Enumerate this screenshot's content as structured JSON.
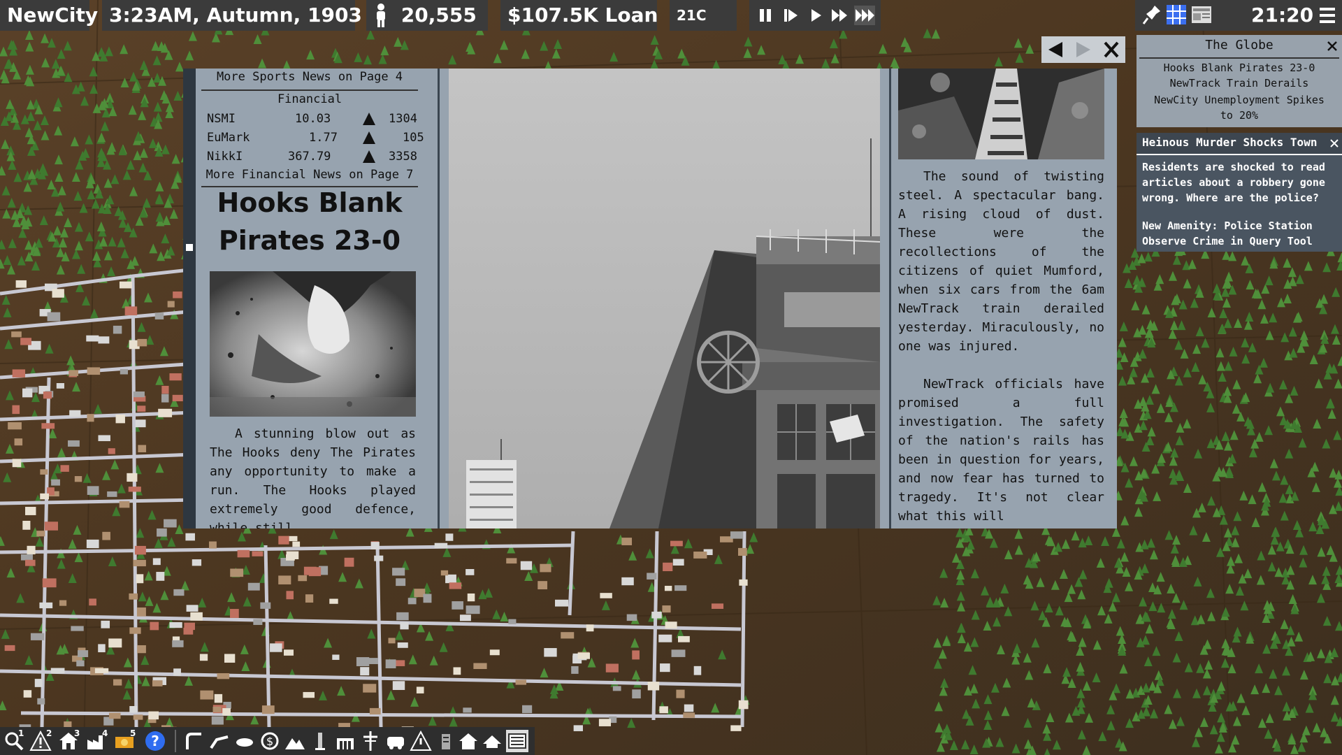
{
  "topbar": {
    "city_name": "NewCity",
    "datetime": "3:23AM, Autumn, 1903",
    "population": "20,555",
    "loan": "$107.5K Loan",
    "temperature": "21C",
    "clock": "21:20"
  },
  "newspaper": {
    "sports_more": "More Sports News on Page 4",
    "financial_heading": "Financial",
    "stocks": [
      {
        "name": "NSMI",
        "value": "10.03",
        "trend": "up",
        "volume": "1304"
      },
      {
        "name": "EuMark",
        "value": "1.77",
        "trend": "up",
        "volume": "105"
      },
      {
        "name": "NikkI",
        "value": "367.79",
        "trend": "up",
        "volume": "3358"
      }
    ],
    "financial_more": "More Financial News on Page 7",
    "headline_line1": "Hooks Blank",
    "headline_line2": "Pirates 23-0",
    "sports_body": "A stunning blow out as The Hooks deny The Pirates any opportunity to make a run. The Hooks played extremely good defence, while still",
    "train_para1": "The sound of twisting steel. A spectacular bang. A rising cloud of dust. These were the recollections of the citizens of quiet Mumford, when six cars from the 6am NewTrack train derailed yesterday. Miraculously, no one was injured.",
    "train_para2": "NewTrack officials have promised a full investigation. The safety of the nation's rails has been in question for years, and now fear has turned to tragedy. It's not clear what this will"
  },
  "globe_panel": {
    "title": "The Globe",
    "items": [
      "Hooks Blank Pirates 23-0",
      "NewTrack Train Derails",
      "NewCity Unemployment Spikes to 20%"
    ]
  },
  "alert_panel": {
    "title": "Heinous Murder Shocks Town",
    "body": "Residents are shocked to read articles about a robbery gone wrong. Where are the police?",
    "amenity_line1": "New Amenity: Police Station",
    "amenity_line2": "Observe Crime in Query Tool"
  },
  "bottombar": {
    "badges": [
      "1",
      "2",
      "3",
      "4",
      "5"
    ],
    "help_label": "?"
  },
  "colors": {
    "paper": "#97a3af",
    "topbar": "#3b3b3b",
    "alert_header": "#3d4650",
    "map_dirt": "#5a4128",
    "road": "#c8c8d2"
  }
}
